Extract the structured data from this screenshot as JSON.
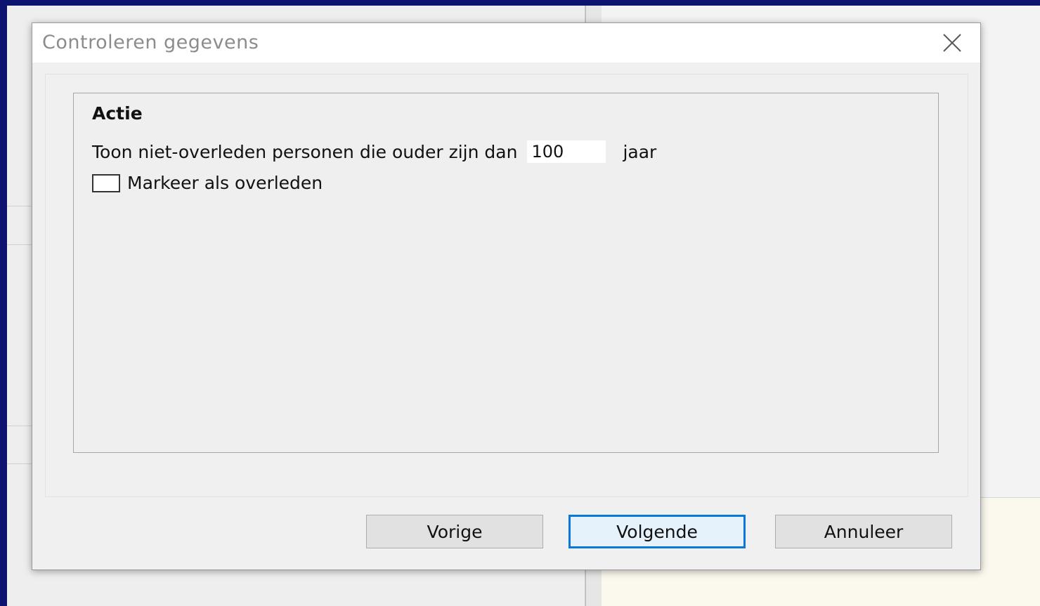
{
  "dialog": {
    "title": "Controleren gegevens",
    "close_icon": "close-icon"
  },
  "group": {
    "title": "Actie",
    "age_label": "Toon niet-overleden personen die ouder zijn dan",
    "age_value": "100",
    "age_unit": "jaar",
    "mark_deceased_label": "Markeer als overleden",
    "mark_deceased_checked": false
  },
  "buttons": {
    "previous": "Vorige",
    "next": "Volgende",
    "cancel": "Annuleer"
  },
  "colors": {
    "focus_accent": "#0a78d7",
    "desktop_background": "#0d1470"
  }
}
